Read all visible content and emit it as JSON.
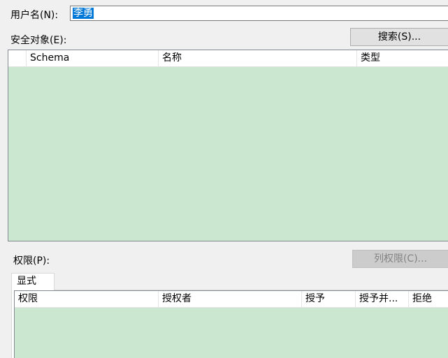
{
  "username": {
    "label": "用户名(N):",
    "value": "李勇"
  },
  "securables": {
    "label": "安全对象(E):",
    "search_button": "搜索(S)...",
    "columns": [
      "Schema",
      "名称",
      "类型"
    ],
    "rows": []
  },
  "permissions": {
    "label": "权限(P):",
    "column_permissions_button": "列权限(C)...",
    "tabs": [
      "显式"
    ],
    "columns": [
      "权限",
      "授权者",
      "授予",
      "授予并...",
      "拒绝"
    ],
    "rows": []
  },
  "colors": {
    "grid_background": "#cce7d0",
    "selection": "#0078d7",
    "window": "#f0f0f0"
  }
}
